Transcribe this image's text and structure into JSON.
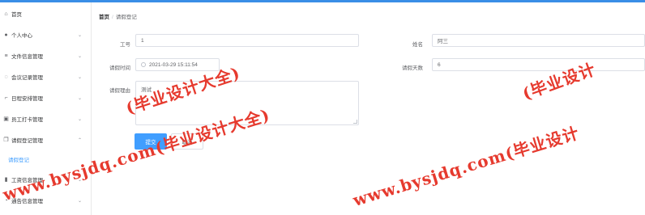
{
  "sidebar": {
    "items": [
      {
        "label": "首页",
        "icon": "home-icon",
        "glyph": "⌂",
        "chevron": ""
      },
      {
        "label": "个人中心",
        "icon": "user-icon",
        "glyph": "●",
        "chevron": "⌄"
      },
      {
        "label": "文件信息管理",
        "icon": "list-icon",
        "glyph": "≡",
        "chevron": "⌄"
      },
      {
        "label": "会议记录管理",
        "icon": "chat-icon",
        "glyph": "◌",
        "chevron": "⌄"
      },
      {
        "label": "日程安排管理",
        "icon": "crop-icon",
        "glyph": "⌐",
        "chevron": "⌄"
      },
      {
        "label": "员工打卡管理",
        "icon": "document-icon",
        "glyph": "▣",
        "chevron": "⌄"
      },
      {
        "label": "请假登记管理",
        "icon": "copy-icon",
        "glyph": "❐",
        "chevron": "⌃"
      },
      {
        "label": "请假登记",
        "icon": "",
        "glyph": "",
        "chevron": ""
      },
      {
        "label": "工资信息管理",
        "icon": "chart-icon",
        "glyph": "▮",
        "chevron": "⌄"
      },
      {
        "label": "通告信息管理",
        "icon": "bell-icon",
        "glyph": "◔",
        "chevron": "⌄"
      }
    ]
  },
  "breadcrumb": {
    "home": "首页",
    "separator": "/",
    "current": "请假登记"
  },
  "form": {
    "gonghao_label": "工号",
    "gonghao_value": "1",
    "xingming_label": "姓名",
    "xingming_value": "阿三",
    "shijian_label": "请假时间",
    "shijian_value": "2021-03-29 15:11:54",
    "tianshu_label": "请假天数",
    "tianshu_value": "6",
    "liyou_label": "请假理由",
    "liyou_value": "测试"
  },
  "buttons": {
    "submit": "提交",
    "cancel": "取消"
  },
  "watermark": {
    "line1": "(毕业设计大全)",
    "line2": "www.bysjdq.com(毕业设计大全)",
    "line3": "(毕业设计",
    "line4": "www.bysjdq.com(毕业设计",
    "color": "#e63a2e"
  },
  "colors": {
    "accent": "#409eff",
    "topbar": "#3a8ee6"
  }
}
